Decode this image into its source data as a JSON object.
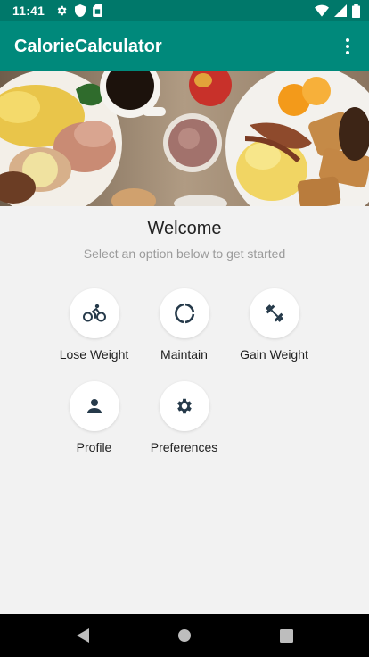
{
  "status_bar": {
    "time": "11:41",
    "left_icons": [
      "gear-icon",
      "shield-icon",
      "sim-card-icon"
    ],
    "right_icons": [
      "wifi-icon",
      "signal-icon",
      "battery-icon"
    ]
  },
  "app_bar": {
    "title": "CalorieCalculator",
    "overflow_icon": "more-vert-icon"
  },
  "colors": {
    "status_bar": "#00786a",
    "app_bar": "#00897b",
    "background": "#f2f2f2",
    "icon": "#263a4a"
  },
  "welcome": {
    "title": "Welcome",
    "subtitle": "Select an option below to get started"
  },
  "options": [
    {
      "label": "Lose Weight",
      "icon": "bicycle-icon"
    },
    {
      "label": "Maintain",
      "icon": "circle-progress-icon"
    },
    {
      "label": "Gain Weight",
      "icon": "dumbbell-icon"
    },
    {
      "label": "Profile",
      "icon": "person-icon"
    },
    {
      "label": "Preferences",
      "icon": "settings-gear-icon"
    }
  ],
  "nav_bar": {
    "buttons": [
      "back-icon",
      "home-icon",
      "recents-icon"
    ]
  }
}
